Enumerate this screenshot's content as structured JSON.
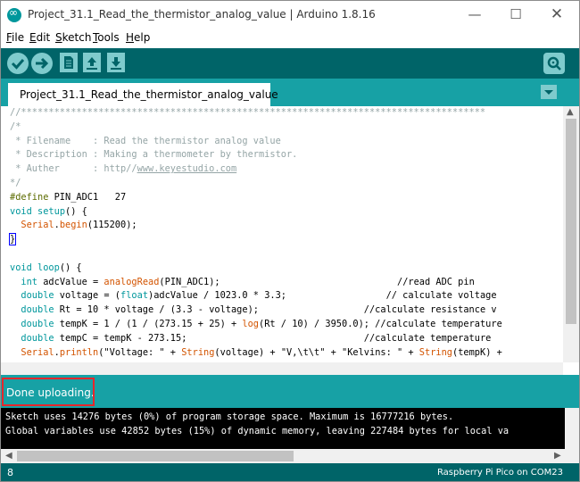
{
  "window": {
    "title": "Project_31.1_Read_the_thermistor_analog_value | Arduino 1.8.16",
    "controls": {
      "minimize": "—",
      "maximize": "☐",
      "close": "✕"
    }
  },
  "menu": [
    {
      "ul": "F",
      "rest": "ile"
    },
    {
      "ul": "E",
      "rest": "dit"
    },
    {
      "ul": "S",
      "rest": "ketch"
    },
    {
      "ul": "T",
      "rest": "ools"
    },
    {
      "ul": "H",
      "rest": "elp"
    }
  ],
  "toolbar": {
    "buttons": [
      "verify-icon",
      "upload-icon",
      "new-icon",
      "open-icon",
      "save-icon"
    ],
    "serial_monitor": "serial-monitor-icon",
    "accent": "#006468",
    "button_color": "#7fcbcd"
  },
  "tab": {
    "label": "Project_31.1_Read_the_thermistor_analog_value"
  },
  "code": [
    [
      {
        "t": "//************************************************************************************",
        "c": "c-com"
      }
    ],
    [
      {
        "t": "/*",
        "c": "c-com"
      }
    ],
    [
      {
        "t": " * Filename    : Read the thermistor analog value",
        "c": "c-com"
      }
    ],
    [
      {
        "t": " * Description : Making a thermometer by thermistor.",
        "c": "c-com"
      }
    ],
    [
      {
        "t": " * Auther      : http//www.keyestudio.com",
        "c": "c-com"
      }
    ],
    [
      {
        "t": "*/",
        "c": "c-com"
      }
    ],
    [
      {
        "t": "#define",
        "c": "c-dir"
      },
      {
        "t": " PIN_ADC1   27",
        "c": ""
      }
    ],
    [
      {
        "t": "void",
        "c": "c-kw"
      },
      {
        "t": " ",
        "c": ""
      },
      {
        "t": "setup",
        "c": "c-kw"
      },
      {
        "t": "() {",
        "c": ""
      }
    ],
    [
      {
        "t": "  ",
        "c": ""
      },
      {
        "t": "Serial",
        "c": "c-fn"
      },
      {
        "t": ".",
        "c": ""
      },
      {
        "t": "begin",
        "c": "c-fn"
      },
      {
        "t": "(115200);",
        "c": ""
      }
    ],
    [
      {
        "t": "}",
        "c": ""
      }
    ],
    [
      {
        "t": "",
        "c": ""
      }
    ],
    [
      {
        "t": "void",
        "c": "c-kw"
      },
      {
        "t": " ",
        "c": ""
      },
      {
        "t": "loop",
        "c": "c-kw"
      },
      {
        "t": "() {",
        "c": ""
      }
    ],
    [
      {
        "t": "  ",
        "c": ""
      },
      {
        "t": "int",
        "c": "c-kw"
      },
      {
        "t": " adcValue = ",
        "c": ""
      },
      {
        "t": "analogRead",
        "c": "c-fn"
      },
      {
        "t": "(PIN_ADC1);                                //read ADC pin",
        "c": ""
      }
    ],
    [
      {
        "t": "  ",
        "c": ""
      },
      {
        "t": "double",
        "c": "c-kw"
      },
      {
        "t": " voltage = (",
        "c": ""
      },
      {
        "t": "float",
        "c": "c-kw"
      },
      {
        "t": ")adcValue / 1023.0 * 3.3;                  // calculate voltage",
        "c": ""
      }
    ],
    [
      {
        "t": "  ",
        "c": ""
      },
      {
        "t": "double",
        "c": "c-kw"
      },
      {
        "t": " Rt = 10 * voltage / (3.3 - voltage);                   //calculate resistance v",
        "c": ""
      }
    ],
    [
      {
        "t": "  ",
        "c": ""
      },
      {
        "t": "double",
        "c": "c-kw"
      },
      {
        "t": " tempK = 1 / (1 / (273.15 + 25) + ",
        "c": ""
      },
      {
        "t": "log",
        "c": "c-fn"
      },
      {
        "t": "(Rt / 10) / 3950.0); //calculate temperature",
        "c": ""
      }
    ],
    [
      {
        "t": "  ",
        "c": ""
      },
      {
        "t": "double",
        "c": "c-kw"
      },
      {
        "t": " tempC = tempK - 273.15;                                //calculate temperature",
        "c": ""
      }
    ],
    [
      {
        "t": "  ",
        "c": ""
      },
      {
        "t": "Serial",
        "c": "c-fn"
      },
      {
        "t": ".",
        "c": ""
      },
      {
        "t": "println",
        "c": "c-fn"
      },
      {
        "t": "(\"Voltage: \" + ",
        "c": ""
      },
      {
        "t": "String",
        "c": "c-fn"
      },
      {
        "t": "(voltage) + \"V,\\t\\t\" + \"Kelvins: \" + ",
        "c": ""
      },
      {
        "t": "String",
        "c": "c-fn"
      },
      {
        "t": "(tempK) +",
        "c": ""
      }
    ]
  ],
  "status": {
    "message": "Done uploading."
  },
  "console": {
    "lines": [
      "Sketch uses 14276 bytes (0%) of program storage space. Maximum is 16777216 bytes.",
      "Global variables use 42852 bytes (15%) of dynamic memory, leaving 227484 bytes for local va"
    ]
  },
  "footer": {
    "line_number": "8",
    "board": "Raspberry Pi Pico on COM23"
  }
}
